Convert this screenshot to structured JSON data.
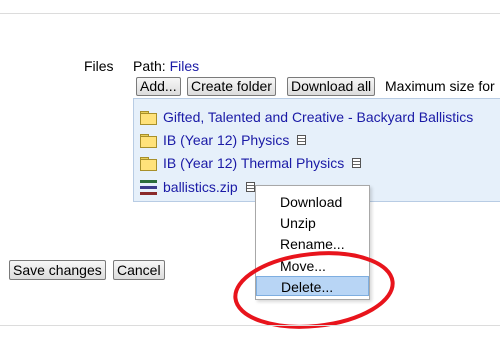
{
  "form": {
    "files_label": "Files",
    "path_prefix": "Path:",
    "path_link": "Files",
    "buttons": {
      "add": "Add...",
      "create_folder": "Create folder",
      "download_all": "Download all"
    },
    "max_size_text": "Maximum size for"
  },
  "files": [
    {
      "name": "Gifted, Talented and Creative - Backyard Ballistics",
      "icon": "folder-icon"
    },
    {
      "name": "IB (Year 12) Physics",
      "icon": "folder-icon"
    },
    {
      "name": "IB (Year 12) Thermal Physics",
      "icon": "folder-icon"
    },
    {
      "name": "ballistics.zip",
      "icon": "zip-archive-icon"
    }
  ],
  "context_menu": {
    "items": [
      "Download",
      "Unzip",
      "Rename...",
      "Move...",
      "Delete..."
    ],
    "selected": "Delete..."
  },
  "actions": {
    "save": "Save changes",
    "cancel": "Cancel"
  },
  "colors": {
    "link": "#1a1aa6",
    "filebox_bg": "#e6f0fa",
    "menu_highlight": "#b8d5f5",
    "annotation": "#e8141c"
  }
}
